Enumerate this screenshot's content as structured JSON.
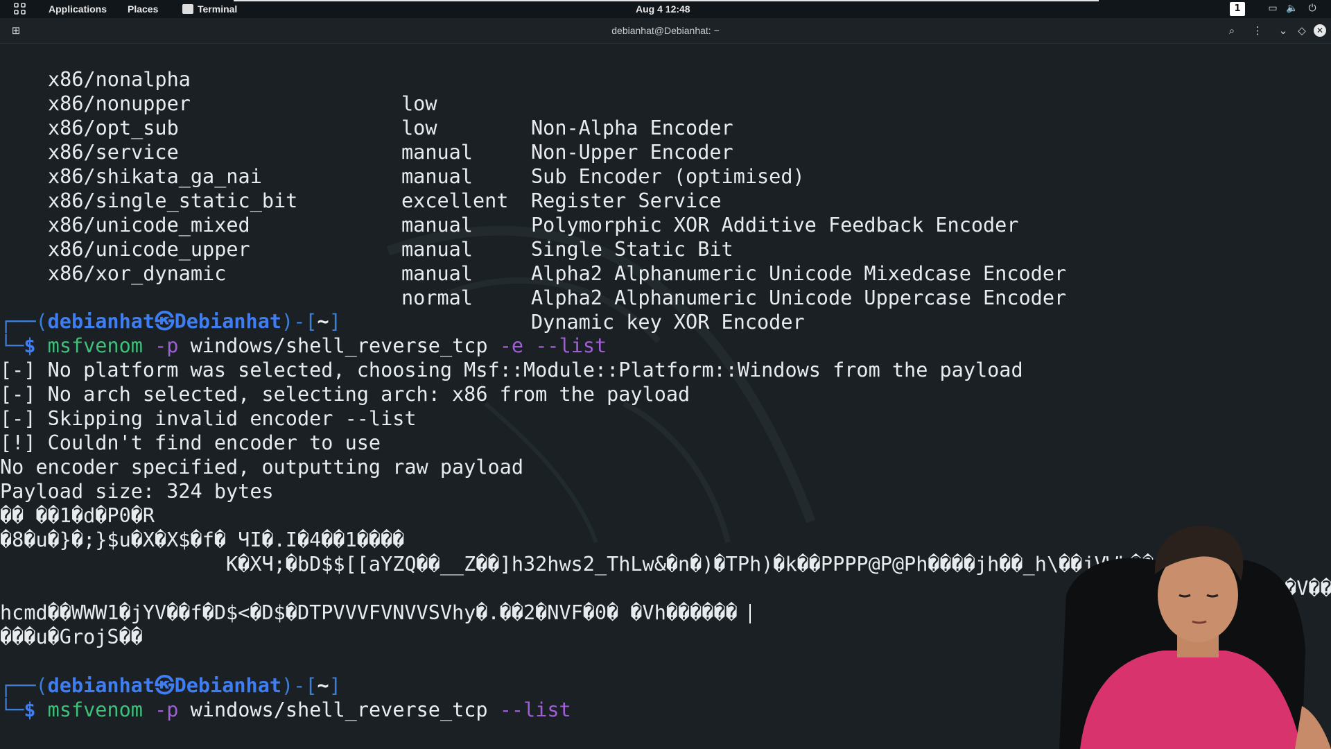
{
  "topbar": {
    "applications": "Applications",
    "places": "Places",
    "terminal": "Terminal",
    "clock": "Aug 4  12:48",
    "workspace": "1"
  },
  "window": {
    "title": "debianhat@Debianhat: ~"
  },
  "encoders": [
    {
      "name": "x86/nonalpha",
      "rank": "low",
      "desc": "Non-Alpha Encoder"
    },
    {
      "name": "x86/nonupper",
      "rank": "low",
      "desc": "Non-Upper Encoder"
    },
    {
      "name": "x86/opt_sub",
      "rank": "manual",
      "desc": "Sub Encoder (optimised)"
    },
    {
      "name": "x86/service",
      "rank": "manual",
      "desc": "Register Service"
    },
    {
      "name": "x86/shikata_ga_nai",
      "rank": "excellent",
      "desc": "Polymorphic XOR Additive Feedback Encoder"
    },
    {
      "name": "x86/single_static_bit",
      "rank": "manual",
      "desc": "Single Static Bit"
    },
    {
      "name": "x86/unicode_mixed",
      "rank": "manual",
      "desc": "Alpha2 Alphanumeric Unicode Mixedcase Encoder"
    },
    {
      "name": "x86/unicode_upper",
      "rank": "manual",
      "desc": "Alpha2 Alphanumeric Unicode Uppercase Encoder"
    },
    {
      "name": "x86/xor_dynamic",
      "rank": "normal",
      "desc": "Dynamic key XOR Encoder"
    }
  ],
  "prompt": {
    "open": "┌──(",
    "user": "debianhat",
    "at": "㉿",
    "host": "Debianhat",
    "close": ")-[",
    "dir": "~",
    "end": "]",
    "corner": "└─",
    "dollar": "$"
  },
  "command1": {
    "bin": "msfvenom",
    "flag_p": "-p",
    "payload": "windows/shell_reverse_tcp",
    "flag_e": "-e",
    "flag_list": "--list"
  },
  "output": [
    "[-] No platform was selected, choosing Msf::Module::Platform::Windows from the payload",
    "[-] No arch selected, selecting arch: x86 from the payload",
    "[-] Skipping invalid encoder --list",
    "[!] Couldn't find encoder to use",
    "No encoder specified, outputting raw payload",
    "Payload size: 324 bytes",
    "�� ��1�d�P0�R",
    "�8�u�}�;}$u�X�X$�f� ЧI�.I�4��1����",
    "                   K�XЧ;�bD$$[[aYZQ��__Z��]h32hws2_ThLw&�n�)�TPh)�k��PPPP@P@Ph����jh��_h\\��jVWh��",
    "                                                                                                          �h�V��",
    "hcmd��WWW1�jYV��f�D$<�D$�DTPVVVFVNVVSVhy�.��2�NVF�0� �Vh������",
    "���u�GrojS��"
  ],
  "command2": {
    "bin": "msfvenom",
    "flag_p": "-p",
    "payload": "windows/shell_reverse_tcp",
    "flag_list": "--list"
  }
}
